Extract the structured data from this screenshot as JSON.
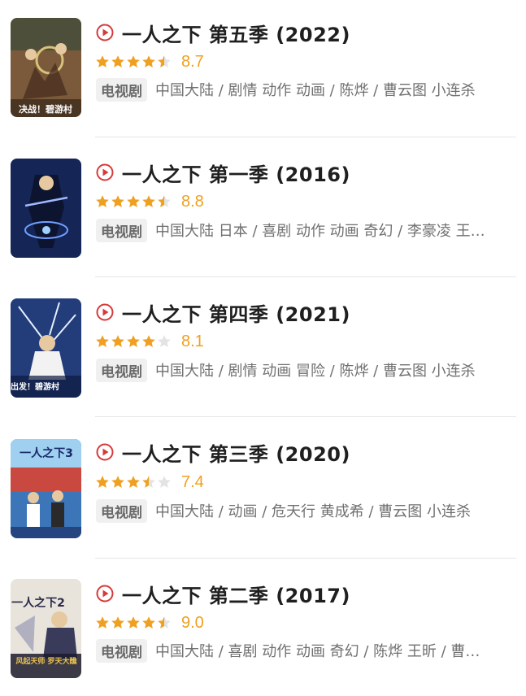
{
  "items": [
    {
      "title": "一人之下 第五季 (2022)",
      "rating": 4.5,
      "score": "8.7",
      "badge": "电视剧",
      "meta": "中国大陆 / 剧情 动作 动画 / 陈烨 / 曹云图 小连杀",
      "poster": {
        "bg": "#7a5a3a",
        "accent": "#d9c27a",
        "caption": "决战！碧游村"
      }
    },
    {
      "title": "一人之下 第一季 (2016)",
      "rating": 4.5,
      "score": "8.8",
      "badge": "电视剧",
      "meta": "中国大陆 日本 / 喜剧 动作 动画 奇幻 / 李豪凌 王…",
      "poster": {
        "bg": "#1c2f6b",
        "accent": "#9fb8ff",
        "caption": ""
      }
    },
    {
      "title": "一人之下 第四季 (2021)",
      "rating": 4.0,
      "score": "8.1",
      "badge": "电视剧",
      "meta": "中国大陆 / 剧情 动画 冒险 / 陈烨 / 曹云图 小连杀",
      "poster": {
        "bg": "#233c7a",
        "accent": "#e4f0ff",
        "caption": "出发！碧游村"
      }
    },
    {
      "title": "一人之下 第三季 (2020)",
      "rating": 3.5,
      "score": "7.4",
      "badge": "电视剧",
      "meta": "中国大陆 / 动画 / 危天行 黄成希 / 曹云图 小连杀",
      "poster": {
        "bg": "#3c76b8",
        "accent": "#c94840",
        "caption": ""
      }
    },
    {
      "title": "一人之下 第二季 (2017)",
      "rating": 4.5,
      "score": "9.0",
      "badge": "电视剧",
      "meta": "中国大陆 / 喜剧 动作 动画 奇幻 / 陈烨 王昕 / 曹…",
      "poster": {
        "bg": "#e8e4dc",
        "accent": "#2a2a4a",
        "caption": "风起天师 罗天大醮"
      }
    }
  ],
  "colors": {
    "star": "#f0a020",
    "star_empty": "#e3e3e3",
    "play": "#d83a3a"
  },
  "icons": {
    "play": "play-circle-icon",
    "star": "star-icon"
  }
}
